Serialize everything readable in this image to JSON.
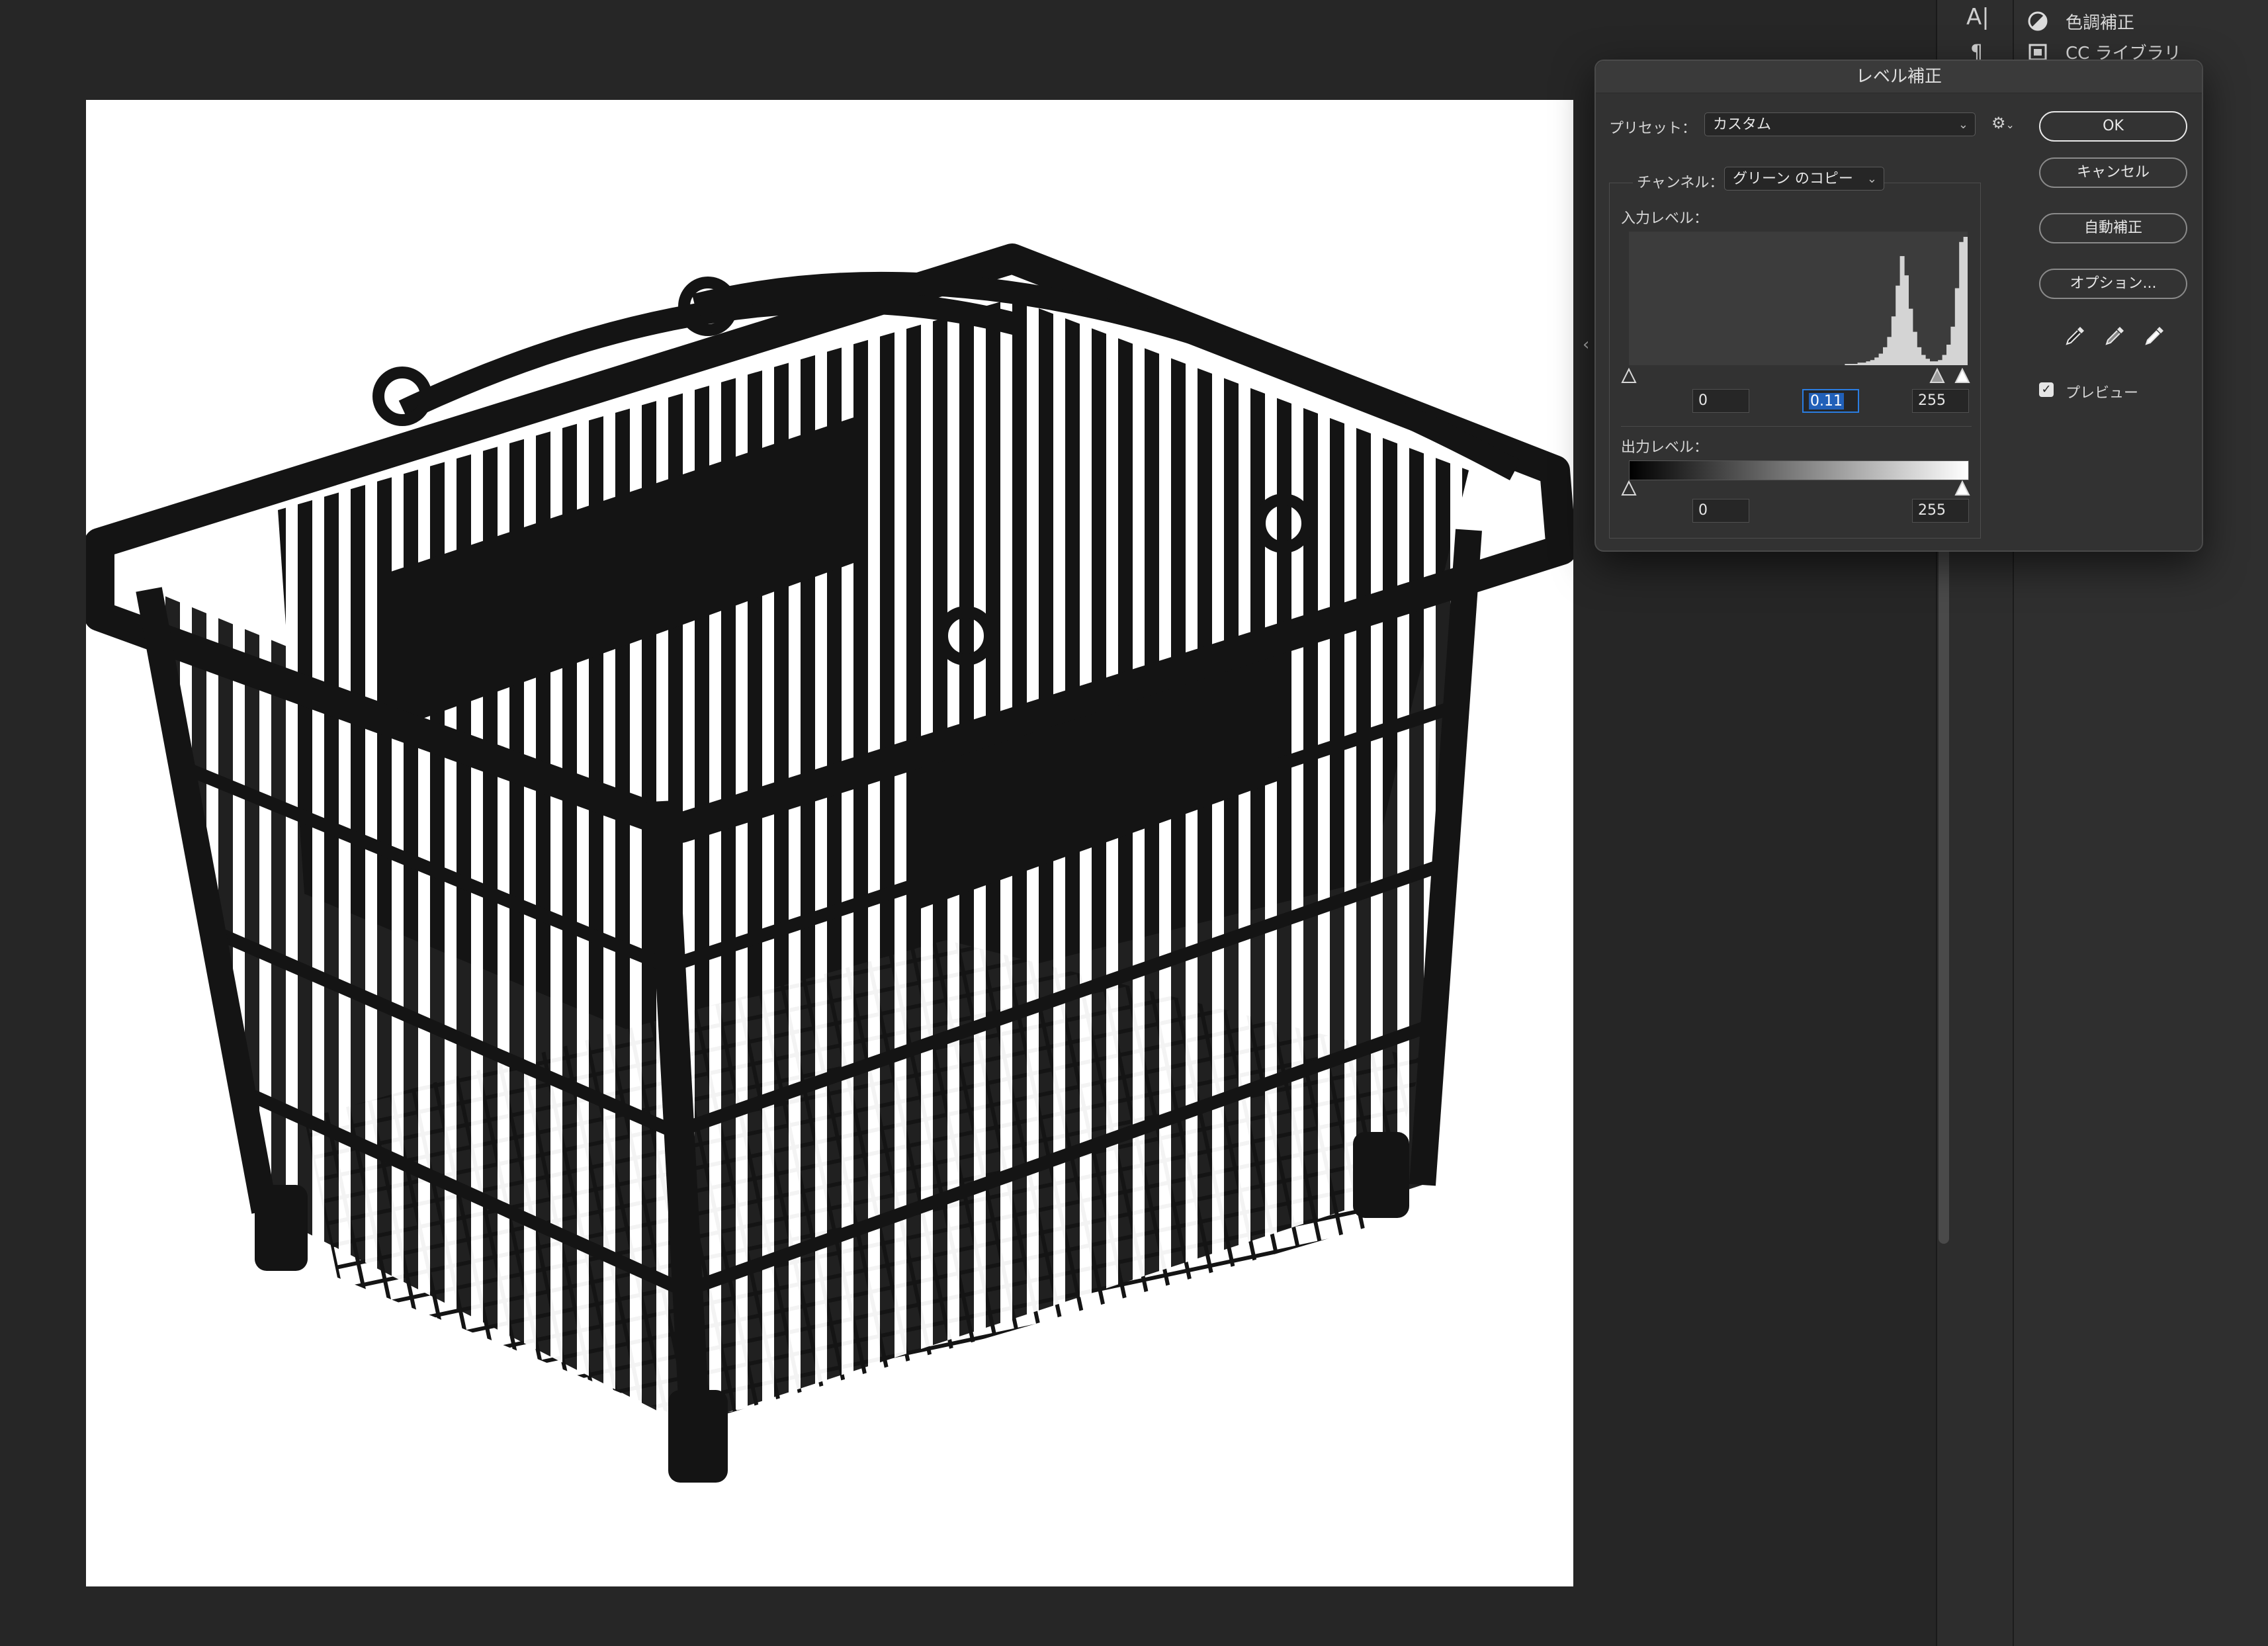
{
  "panels": {
    "items": [
      {
        "label": "色調補正",
        "icon": "adjustment-circle-icon"
      },
      {
        "label": "CC ライブラリ",
        "icon": "library-icon"
      }
    ],
    "tools": [
      "character-icon",
      "paragraph-icon"
    ]
  },
  "dialog": {
    "title": "レベル補正",
    "preset_label": "プリセット：",
    "preset_value": "カスタム",
    "channel_label": "チャンネル：",
    "channel_value": "グリーン のコピー",
    "input_label": "入力レベル：",
    "input_black": "0",
    "input_gamma": "0.11",
    "input_white": "255",
    "output_label": "出力レベル：",
    "output_black": "0",
    "output_white": "255",
    "buttons": {
      "ok": "OK",
      "cancel": "キャンセル",
      "auto": "自動補正",
      "options": "オプション..."
    },
    "preview_label": "プレビュー",
    "preview_checked": true,
    "histogram": {
      "bins": [
        0,
        0,
        0,
        0,
        0,
        0,
        0,
        0,
        0,
        0,
        0,
        0,
        0,
        0,
        0,
        0,
        0,
        0,
        0,
        0,
        0,
        0,
        0,
        0,
        0,
        0,
        0,
        0,
        0,
        0,
        0,
        0,
        0,
        0,
        0,
        0,
        0,
        0,
        0,
        0,
        0,
        0,
        0,
        0,
        0,
        0,
        0,
        0,
        0,
        0,
        0,
        1,
        1,
        1,
        2,
        2,
        3,
        4,
        6,
        9,
        14,
        22,
        38,
        62,
        85,
        70,
        44,
        26,
        14,
        8,
        5,
        3,
        3,
        4,
        8,
        16,
        30,
        60,
        96,
        100
      ]
    }
  },
  "colors": {
    "accent": "#2a7de1",
    "app_bg": "#262626",
    "dialog_bg": "#323232"
  }
}
